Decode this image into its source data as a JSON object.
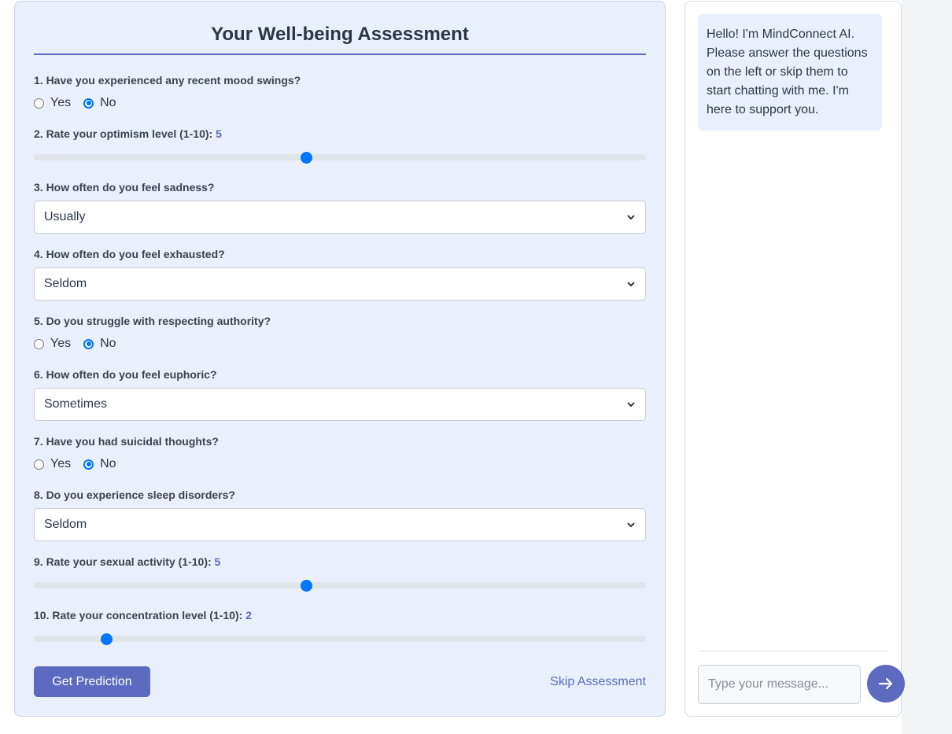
{
  "assessment": {
    "title": "Your Well-being Assessment",
    "q1": {
      "label": "1. Have you experienced any recent mood swings?",
      "options": [
        "Yes",
        "No"
      ],
      "selected": "No"
    },
    "q2": {
      "label": "2. Rate your optimism level (1-10):",
      "value": "5",
      "min": 1,
      "max": 10
    },
    "q3": {
      "label": "3. How often do you feel sadness?",
      "selected": "Usually"
    },
    "q4": {
      "label": "4. How often do you feel exhausted?",
      "selected": "Seldom"
    },
    "q5": {
      "label": "5. Do you struggle with respecting authority?",
      "options": [
        "Yes",
        "No"
      ],
      "selected": "No"
    },
    "q6": {
      "label": "6. How often do you feel euphoric?",
      "selected": "Sometimes"
    },
    "q7": {
      "label": "7. Have you had suicidal thoughts?",
      "options": [
        "Yes",
        "No"
      ],
      "selected": "No"
    },
    "q8": {
      "label": "8. Do you experience sleep disorders?",
      "selected": "Seldom"
    },
    "q9": {
      "label": "9. Rate your sexual activity (1-10):",
      "value": "5",
      "min": 1,
      "max": 10
    },
    "q10": {
      "label": "10. Rate your concentration level (1-10):",
      "value": "2",
      "min": 1,
      "max": 10
    },
    "predict_label": "Get Prediction",
    "skip_label": "Skip Assessment"
  },
  "chat": {
    "greeting": "Hello! I'm MindConnect AI. Please answer the questions on the left or skip them to start chatting with me. I'm here to support you.",
    "input_placeholder": "Type your message...",
    "send_icon": "arrow-right-icon"
  },
  "colors": {
    "accent": "#5c6bc0",
    "control_blue": "#0075ff",
    "panel_bg": "#e9f0fb"
  }
}
